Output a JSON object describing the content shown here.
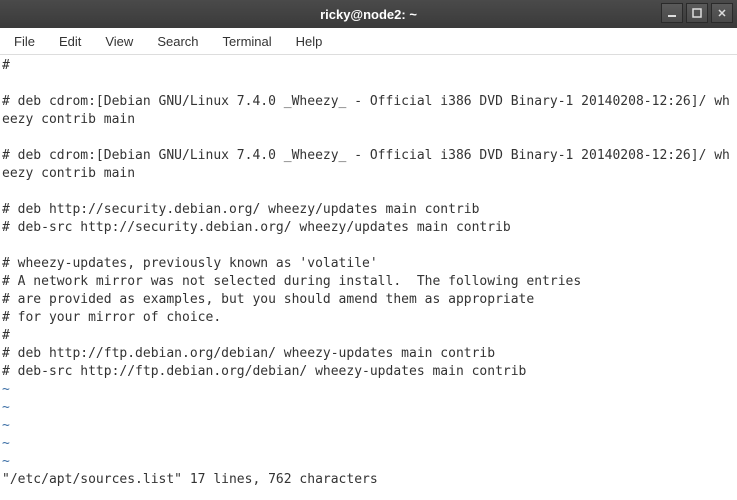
{
  "titlebar": {
    "title": "ricky@node2: ~"
  },
  "menubar": {
    "file": "File",
    "edit": "Edit",
    "view": "View",
    "search": "Search",
    "terminal": "Terminal",
    "help": "Help"
  },
  "terminal": {
    "lines": [
      "#",
      "",
      "# deb cdrom:[Debian GNU/Linux 7.4.0 _Wheezy_ - Official i386 DVD Binary-1 20140208-12:26]/ wheezy contrib main",
      "",
      "# deb cdrom:[Debian GNU/Linux 7.4.0 _Wheezy_ - Official i386 DVD Binary-1 20140208-12:26]/ wheezy contrib main",
      "",
      "# deb http://security.debian.org/ wheezy/updates main contrib",
      "# deb-src http://security.debian.org/ wheezy/updates main contrib",
      "",
      "# wheezy-updates, previously known as 'volatile'",
      "# A network mirror was not selected during install.  The following entries",
      "# are provided as examples, but you should amend them as appropriate",
      "# for your mirror of choice.",
      "#",
      "# deb http://ftp.debian.org/debian/ wheezy-updates main contrib",
      "# deb-src http://ftp.debian.org/debian/ wheezy-updates main contrib"
    ],
    "tildes": [
      "~",
      "~",
      "~",
      "~",
      "~"
    ],
    "status": "\"/etc/apt/sources.list\" 17 lines, 762 characters"
  }
}
